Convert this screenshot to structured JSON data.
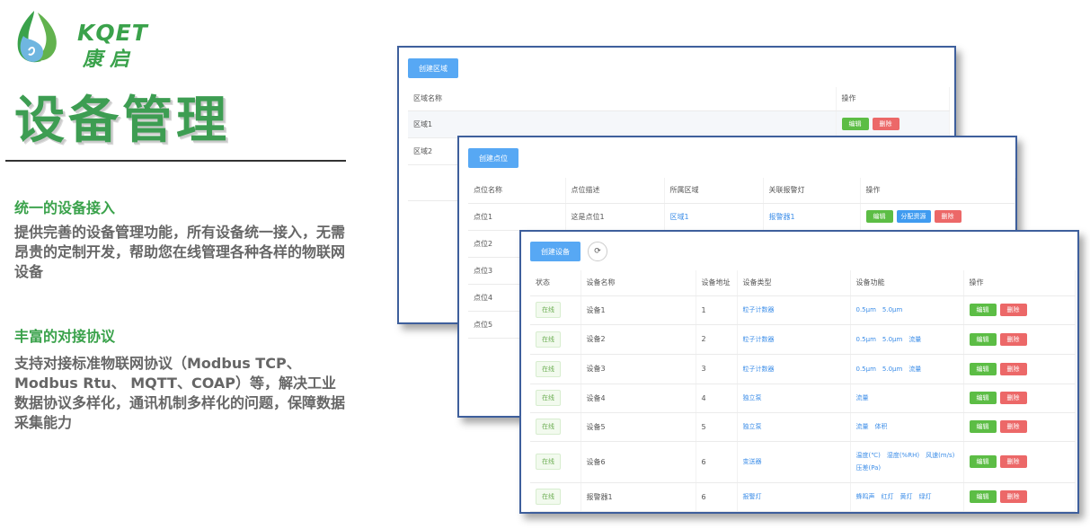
{
  "brand": {
    "name_en": "KQET",
    "name_zh": "康启",
    "color": "#3aa24b"
  },
  "title": "设备管理",
  "sections": [
    {
      "heading": "统一的设备接入",
      "text": "提供完善的设备管理功能，所有设备统一接入，无需昂贵的定制开发，帮助您在线管理各种各样的物联网设备"
    },
    {
      "heading": "丰富的对接协议",
      "text": "支持对接标准物联网协议（Modbus TCP、Modbus Rtu、 MQTT、COAP）等，解决工业数据协议多样化，通讯机制多样化的问题，保障数据采集能力"
    }
  ],
  "area_window": {
    "create_label": "创建区域",
    "columns": [
      "区域名称",
      "操作"
    ],
    "rows": [
      "区域1",
      "区域2"
    ],
    "edit_label": "编辑",
    "delete_label": "删除"
  },
  "point_window": {
    "create_label": "创建点位",
    "columns": [
      "点位名称",
      "点位描述",
      "所属区域",
      "关联报警灯",
      "操作"
    ],
    "rows": [
      {
        "name": "点位1",
        "desc": "这是点位1",
        "area": "区域1",
        "alarm": "报警器1"
      },
      {
        "name": "点位2"
      },
      {
        "name": "点位3"
      },
      {
        "name": "点位4"
      },
      {
        "name": "点位5"
      }
    ],
    "edit_label": "编辑",
    "assign_label": "分配资源",
    "delete_label": "删除"
  },
  "device_window": {
    "create_label": "创建设备",
    "columns": [
      "状态",
      "设备名称",
      "设备地址",
      "设备类型",
      "设备功能",
      "操作"
    ],
    "status_label": "在线",
    "edit_label": "编辑",
    "delete_label": "删除",
    "rows": [
      {
        "name": "设备1",
        "addr": "1",
        "type": "粒子计数器",
        "features": [
          "0.5μm",
          "5.0μm"
        ]
      },
      {
        "name": "设备2",
        "addr": "2",
        "type": "粒子计数器",
        "features": [
          "0.5μm",
          "5.0μm",
          "流量"
        ]
      },
      {
        "name": "设备3",
        "addr": "3",
        "type": "粒子计数器",
        "features": [
          "0.5μm",
          "5.0μm",
          "流量"
        ]
      },
      {
        "name": "设备4",
        "addr": "4",
        "type": "独立泵",
        "features": [
          "流量"
        ]
      },
      {
        "name": "设备5",
        "addr": "5",
        "type": "独立泵",
        "features": [
          "流量",
          "体积"
        ]
      },
      {
        "name": "设备6",
        "addr": "6",
        "type": "变送器",
        "features": [
          "温度(℃)",
          "湿度(%RH)",
          "风速(m/s)",
          "压差(Pa)"
        ]
      },
      {
        "name": "报警器1",
        "addr": "6",
        "type": "报警灯",
        "features": [
          "蜂鸣声",
          "红灯",
          "黄灯",
          "绿灯"
        ]
      }
    ]
  }
}
